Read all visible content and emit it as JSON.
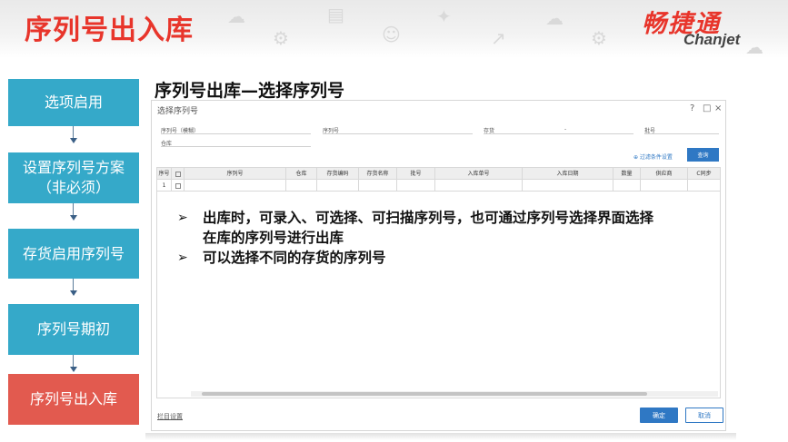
{
  "slide": {
    "title": "序列号出入库",
    "logo_cn": "畅捷通",
    "logo_en": "Chanjet",
    "heading": "序列号出库—选择序列号"
  },
  "steps": [
    {
      "label": "选项启用",
      "active": false
    },
    {
      "label": "设置序列号方案（非必须）",
      "active": false
    },
    {
      "label": "存货启用序列号",
      "active": false
    },
    {
      "label": "序列号期初",
      "active": false
    },
    {
      "label": "序列号出入库",
      "active": true
    }
  ],
  "dialog": {
    "title": "选择序列号",
    "controls": {
      "help": "?",
      "maximize": "□",
      "close": "×"
    },
    "fields": [
      {
        "label": "序列号（模糊）"
      },
      {
        "label": "序列号"
      },
      {
        "label": "存货"
      },
      {
        "label": "批号"
      },
      {
        "label": "仓库"
      }
    ],
    "inventory_dash": "-",
    "filter_link": "⊕ 过滤条件设置",
    "query_button": "查询",
    "columns": [
      "序号",
      "",
      "序列号",
      "仓库",
      "存货编码",
      "存货名称",
      "批号",
      "入库单号",
      "入库日期",
      "数量",
      "供应商",
      "C同步"
    ],
    "row_index": "1",
    "column_settings": "栏目设置",
    "ok_button": "确定",
    "cancel_button": "取消"
  },
  "bullets": [
    "出库时，可录入、可选择、可扫描序列号，也可通过序列号选择界面选择在库的序列号进行出库",
    "可以选择不同的存货的序列号"
  ],
  "colors": {
    "accent_red": "#e8352b",
    "step_blue": "#35a9c9",
    "step_active": "#e25a4f",
    "button_blue": "#2f78c4"
  }
}
